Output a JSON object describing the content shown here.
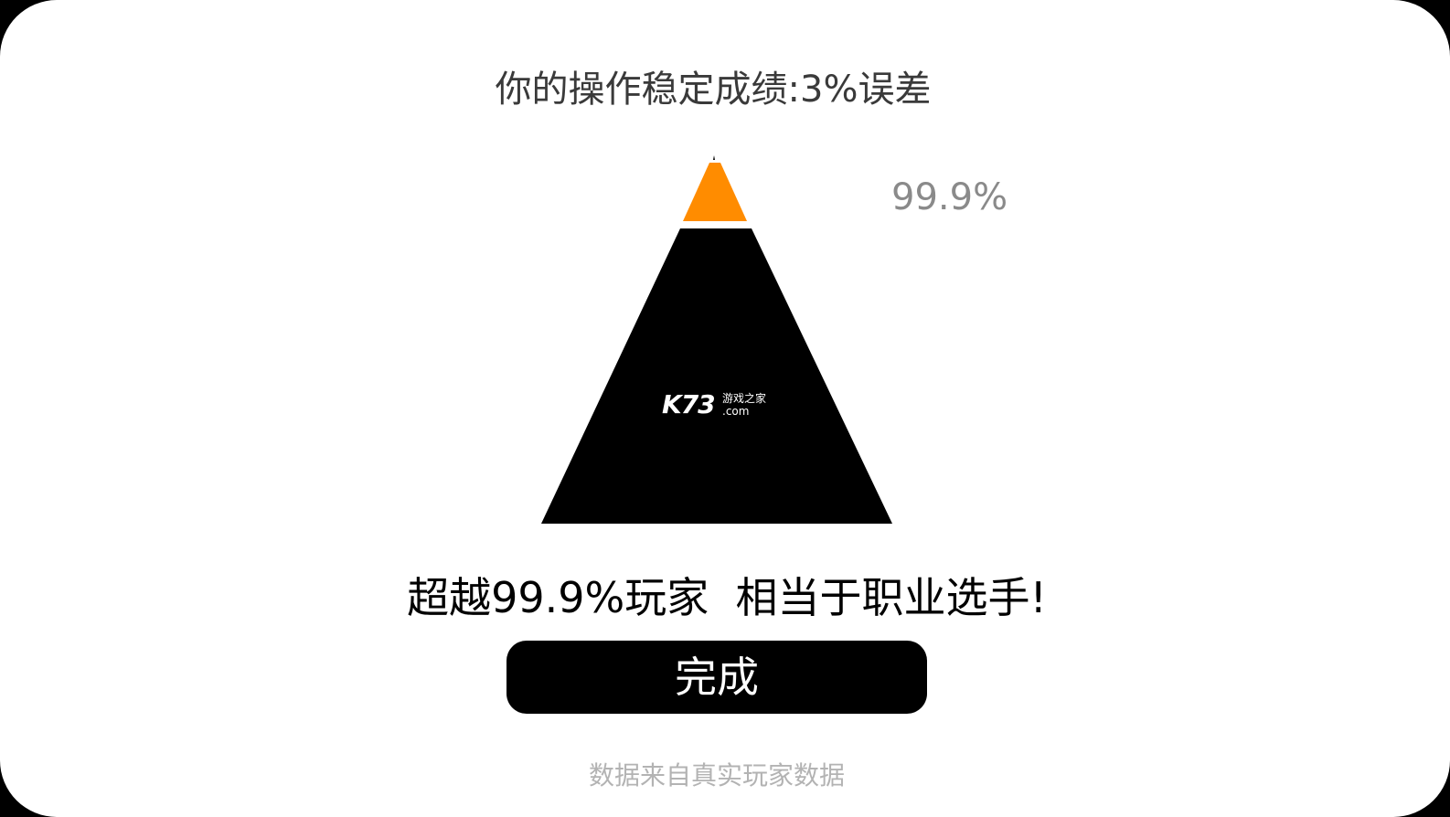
{
  "header": {
    "score_title": "你的操作稳定成绩:3%误差"
  },
  "pyramid": {
    "percentile_label": "99.9%",
    "top_percentile": 0.999,
    "colors": {
      "top_segment": "#FF8C00",
      "base_segment": "#000000"
    }
  },
  "watermark": {
    "logo": "K73",
    "subtitle_cn": "游戏之家",
    "domain": ".com"
  },
  "result": {
    "message": "超越99.9%玩家  相当于职业选手!"
  },
  "actions": {
    "done_label": "完成"
  },
  "footer": {
    "source_note": "数据来自真实玩家数据"
  }
}
